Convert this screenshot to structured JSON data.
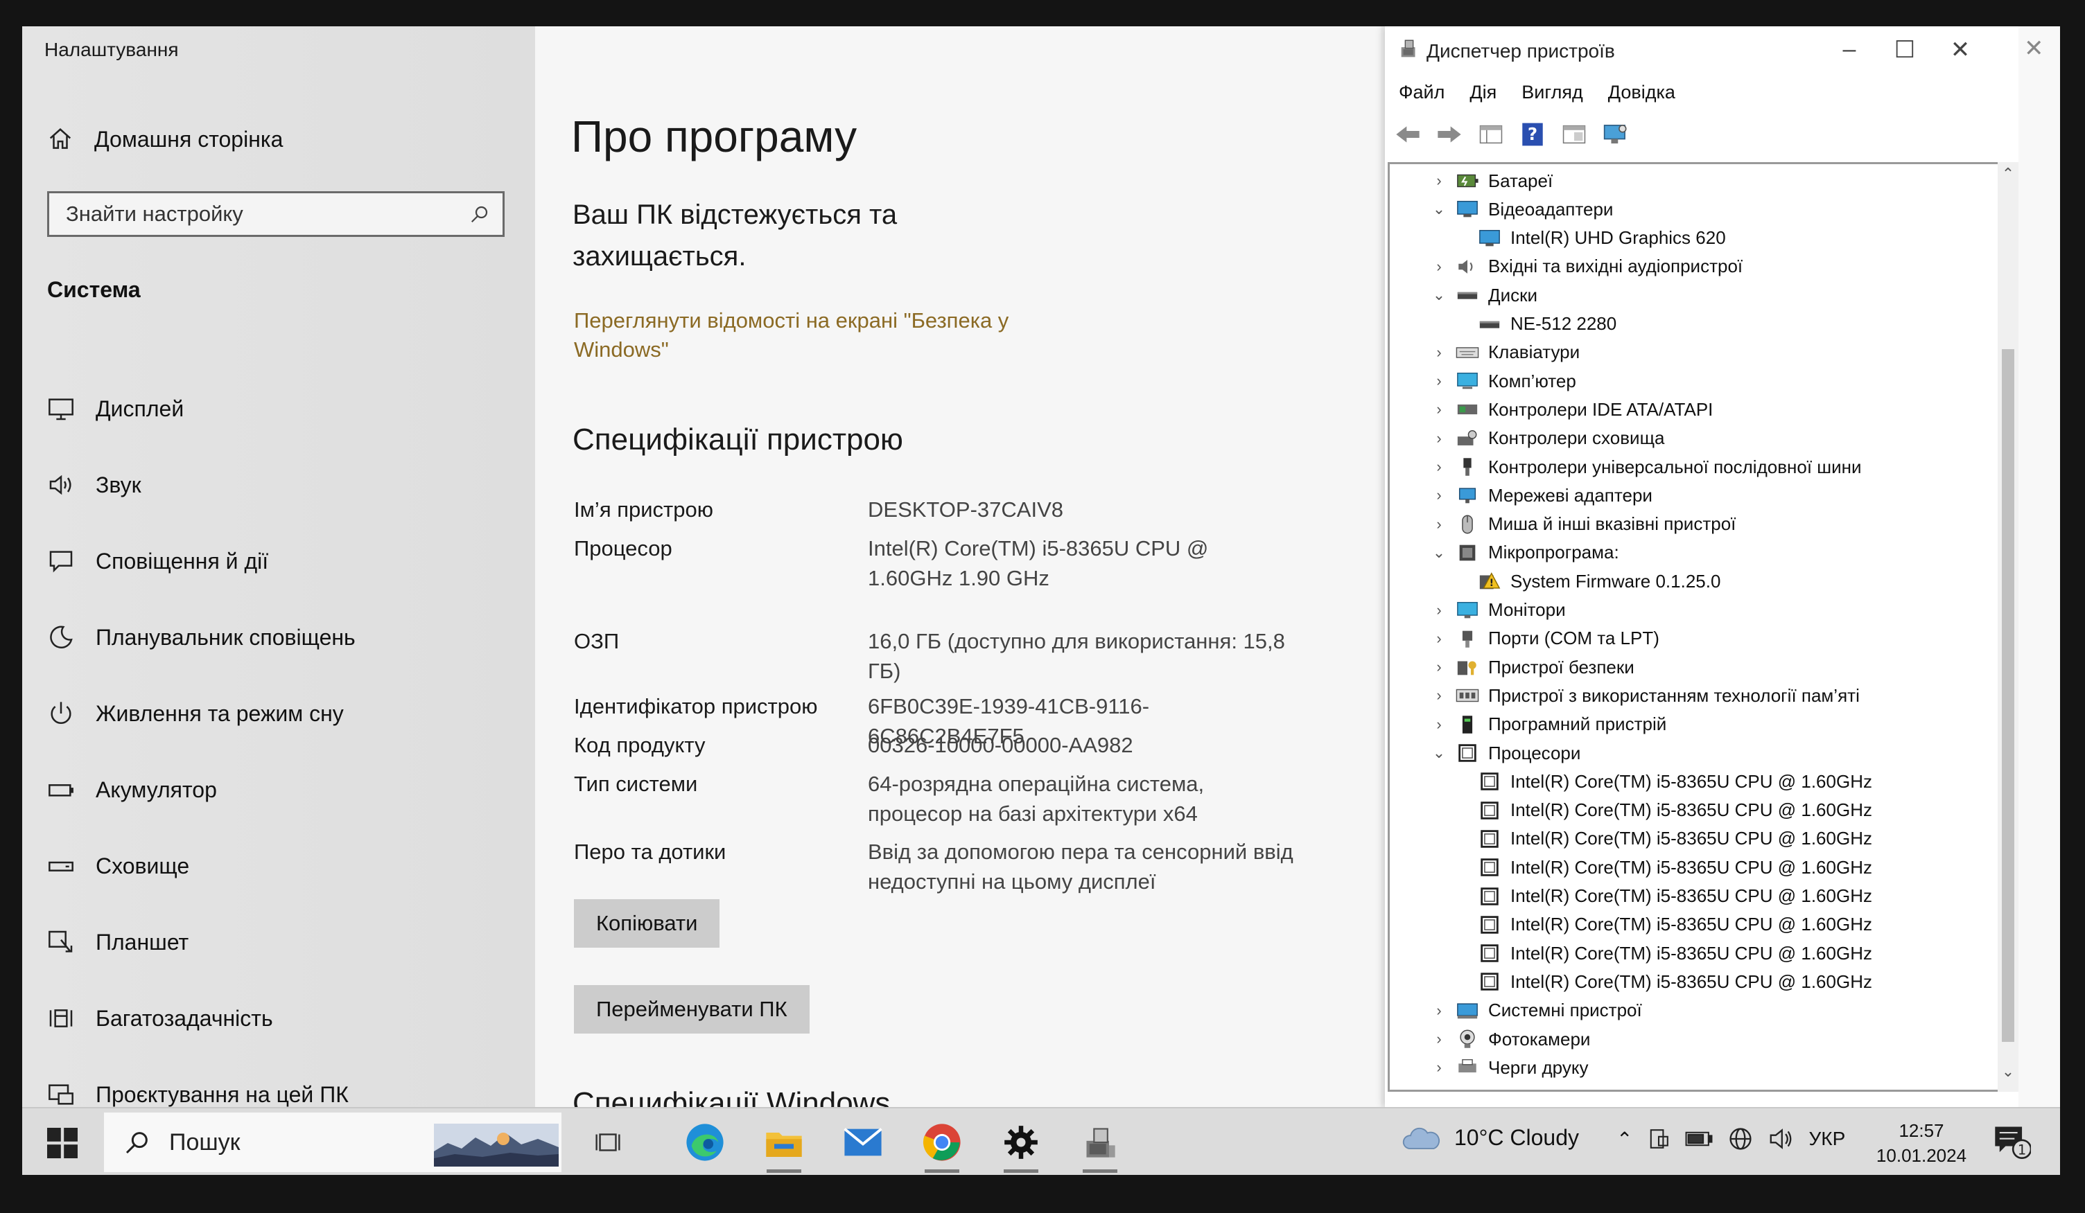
{
  "settings": {
    "app_title": "Налаштування",
    "home": "Домашня сторінка",
    "search_placeholder": "Знайти настройку",
    "section": "Система",
    "nav": [
      {
        "label": "Дисплей",
        "icon": "monitor-icon"
      },
      {
        "label": "Звук",
        "icon": "speaker-icon"
      },
      {
        "label": "Сповіщення й дії",
        "icon": "notification-icon"
      },
      {
        "label": "Планувальник сповіщень",
        "icon": "moon-icon"
      },
      {
        "label": "Живлення та режим сну",
        "icon": "power-icon"
      },
      {
        "label": "Акумулятор",
        "icon": "battery-icon"
      },
      {
        "label": "Сховище",
        "icon": "storage-icon"
      },
      {
        "label": "Планшет",
        "icon": "tablet-icon"
      },
      {
        "label": "Багатозадачність",
        "icon": "multitask-icon"
      },
      {
        "label": "Проєктування на цей ПК",
        "icon": "project-icon"
      }
    ],
    "page_title": "Про програму",
    "protection_text": "Ваш ПК відстежується та захищається.",
    "security_link": "Переглянути відомості на екрані \"Безпека у Windows\"",
    "specs_title": "Специфікації пристрою",
    "specs": [
      {
        "label": "Ім’я пристрою",
        "value": "DESKTOP-37CAIV8"
      },
      {
        "label": "Процесор",
        "value": "Intel(R) Core(TM) i5-8365U CPU @ 1.60GHz   1.90 GHz"
      },
      {
        "label": "ОЗП",
        "value": "16,0 ГБ (доступно для використання: 15,8 ГБ)"
      },
      {
        "label": "Ідентифікатор пристрою",
        "value": "6FB0C39E-1939-41CB-9116-6C86C2B4E7F5"
      },
      {
        "label": "Код продукту",
        "value": "00326-10000-00000-AA982"
      },
      {
        "label": "Тип системи",
        "value": "64-розрядна операційна система, процесор на базі архітектури x64"
      },
      {
        "label": "Перо та дотики",
        "value": "Ввід за допомогою пера та сенсорний ввід недоступні на цьому дисплеї"
      }
    ],
    "copy_button": "Копіювати",
    "rename_button": "Перейменувати ПК",
    "windows_specs_title": "Специфікації Windows"
  },
  "devmgr": {
    "title": "Диспетчер пристроїв",
    "menu": [
      "Файл",
      "Дія",
      "Вигляд",
      "Довідка"
    ],
    "tree": [
      {
        "label": "Батареї",
        "level": 0,
        "expanded": false,
        "icon": "battery-device-icon"
      },
      {
        "label": "Відеоадаптери",
        "level": 0,
        "expanded": true,
        "icon": "display-adapter-icon"
      },
      {
        "label": "Intel(R) UHD Graphics 620",
        "level": 1,
        "icon": "display-adapter-icon"
      },
      {
        "label": "Вхідні та вихідні аудіопристрої",
        "level": 0,
        "expanded": false,
        "icon": "audio-icon"
      },
      {
        "label": "Диски",
        "level": 0,
        "expanded": true,
        "icon": "disk-icon"
      },
      {
        "label": "NE-512 2280",
        "level": 1,
        "icon": "disk-icon"
      },
      {
        "label": "Клавіатури",
        "level": 0,
        "expanded": false,
        "icon": "keyboard-icon"
      },
      {
        "label": "Комп’ютер",
        "level": 0,
        "expanded": false,
        "icon": "computer-icon"
      },
      {
        "label": "Контролери IDE ATA/ATAPI",
        "level": 0,
        "expanded": false,
        "icon": "ide-icon"
      },
      {
        "label": "Контролери сховища",
        "level": 0,
        "expanded": false,
        "icon": "storage-controller-icon"
      },
      {
        "label": "Контролери універсальної послідовної шини",
        "level": 0,
        "expanded": false,
        "icon": "usb-icon"
      },
      {
        "label": "Мережеві адаптери",
        "level": 0,
        "expanded": false,
        "icon": "network-icon"
      },
      {
        "label": "Миша й інші вказівні пристрої",
        "level": 0,
        "expanded": false,
        "icon": "mouse-icon"
      },
      {
        "label": "Мікропрограма:",
        "level": 0,
        "expanded": true,
        "icon": "firmware-icon"
      },
      {
        "label": "System Firmware 0.1.25.0",
        "level": 1,
        "icon": "firmware-warning-icon"
      },
      {
        "label": "Монітори",
        "level": 0,
        "expanded": false,
        "icon": "monitor-device-icon"
      },
      {
        "label": "Порти (COM та LPT)",
        "level": 0,
        "expanded": false,
        "icon": "port-icon"
      },
      {
        "label": "Пристрої безпеки",
        "level": 0,
        "expanded": false,
        "icon": "security-device-icon"
      },
      {
        "label": "Пристрої з використанням технології пам’яті",
        "level": 0,
        "expanded": false,
        "icon": "memory-icon"
      },
      {
        "label": "Програмний пристрій",
        "level": 0,
        "expanded": false,
        "icon": "software-device-icon"
      },
      {
        "label": "Процесори",
        "level": 0,
        "expanded": true,
        "icon": "cpu-icon"
      },
      {
        "label": "Intel(R) Core(TM) i5-8365U CPU @ 1.60GHz",
        "level": 1,
        "icon": "cpu-icon"
      },
      {
        "label": "Intel(R) Core(TM) i5-8365U CPU @ 1.60GHz",
        "level": 1,
        "icon": "cpu-icon"
      },
      {
        "label": "Intel(R) Core(TM) i5-8365U CPU @ 1.60GHz",
        "level": 1,
        "icon": "cpu-icon"
      },
      {
        "label": "Intel(R) Core(TM) i5-8365U CPU @ 1.60GHz",
        "level": 1,
        "icon": "cpu-icon"
      },
      {
        "label": "Intel(R) Core(TM) i5-8365U CPU @ 1.60GHz",
        "level": 1,
        "icon": "cpu-icon"
      },
      {
        "label": "Intel(R) Core(TM) i5-8365U CPU @ 1.60GHz",
        "level": 1,
        "icon": "cpu-icon"
      },
      {
        "label": "Intel(R) Core(TM) i5-8365U CPU @ 1.60GHz",
        "level": 1,
        "icon": "cpu-icon"
      },
      {
        "label": "Intel(R) Core(TM) i5-8365U CPU @ 1.60GHz",
        "level": 1,
        "icon": "cpu-icon"
      },
      {
        "label": "Системні пристрої",
        "level": 0,
        "expanded": false,
        "icon": "system-device-icon"
      },
      {
        "label": "Фотокамери",
        "level": 0,
        "expanded": false,
        "icon": "camera-icon"
      },
      {
        "label": "Черги друку",
        "level": 0,
        "expanded": false,
        "icon": "print-queue-icon"
      }
    ]
  },
  "taskbar": {
    "search": "Пошук",
    "weather": "10°C  Cloudy",
    "language": "УКР",
    "time": "12:57",
    "date": "10.01.2024",
    "notification_count": "1",
    "apps": [
      "task-view-icon",
      "edge-icon",
      "file-explorer-icon",
      "mail-icon",
      "chrome-icon",
      "settings-icon",
      "device-manager-icon"
    ]
  },
  "colors": {
    "link": "#8b6a24",
    "sidebar_bg": "#e2e2e2",
    "content_bg": "#f6f6f6",
    "button_bg": "#cccccc",
    "taskbar_bg": "#dcdcdc"
  }
}
